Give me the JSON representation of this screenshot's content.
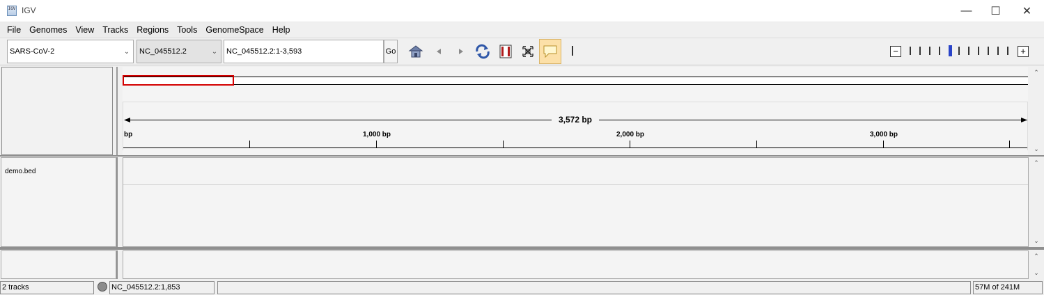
{
  "window": {
    "title": "IGV",
    "app_icon_text": "IGV"
  },
  "menu": [
    "File",
    "Genomes",
    "View",
    "Tracks",
    "Regions",
    "Tools",
    "GenomeSpace",
    "Help"
  ],
  "toolbar": {
    "genome": "SARS-CoV-2",
    "chromosome": "NC_045512.2",
    "locus": "NC_045512.2:1-3,593",
    "go_label": "Go",
    "icons": [
      "home-icon",
      "back-icon",
      "forward-icon",
      "refresh-icon",
      "region-of-interest-icon",
      "resize-to-window-icon",
      "popup-info-icon"
    ],
    "zoom_levels": 11,
    "zoom_current": 4
  },
  "ruler": {
    "span_label": "3,572 bp",
    "tick_labels": [
      "bp",
      "1,000 bp",
      "2,000 bp",
      "3,000 bp"
    ]
  },
  "tracks": {
    "names": [
      "demo.bed"
    ]
  },
  "status": {
    "track_count": "2 tracks",
    "position": "NC_045512.2:1,853",
    "memory": "57M of 241M"
  },
  "colors": {
    "region_box": "#d40000",
    "zoom_current": "#2a44c8",
    "popup_btn_bg": "#fce0a8"
  }
}
